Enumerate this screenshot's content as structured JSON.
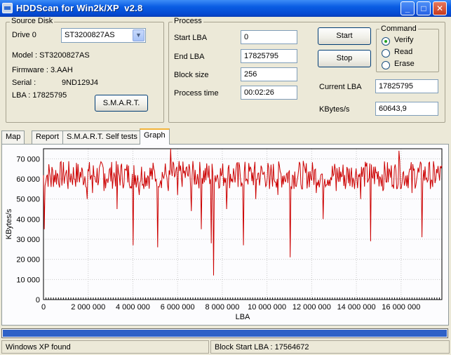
{
  "window": {
    "title": "HDDScan for Win2k/XP  v2.8"
  },
  "source_disk": {
    "group_label": "Source Disk",
    "drive_label": "Drive  0",
    "drive_value": "ST3200827AS",
    "model": "Model : ST3200827AS",
    "firmware": "Firmware : 3.AAH",
    "serial_label": "Serial :",
    "serial_value": "9ND129J4",
    "lba": "LBA :  17825795",
    "smart_button": "S.M.A.R.T."
  },
  "process": {
    "group_label": "Process",
    "start_lba_label": "Start LBA",
    "start_lba_value": "0",
    "end_lba_label": "End LBA",
    "end_lba_value": "17825795",
    "block_size_label": "Block size",
    "block_size_value": "256",
    "process_time_label": "Process time",
    "process_time_value": "00:02:26",
    "start_button": "Start",
    "stop_button": "Stop",
    "current_lba_label": "Current LBA",
    "current_lba_value": "17825795",
    "kbytes_label": "KBytes/s",
    "kbytes_value": "60643,9"
  },
  "command": {
    "group_label": "Command",
    "options": [
      "Verify",
      "Read",
      "Erase"
    ],
    "selected": "Verify"
  },
  "tabs": [
    "Map",
    "Report",
    "S.M.A.R.T. Self tests",
    "Graph"
  ],
  "active_tab": "Graph",
  "chart_data": {
    "type": "line",
    "xlabel": "LBA",
    "ylabel": "KBytes/s",
    "xlim": [
      0,
      17825795
    ],
    "ylim": [
      0,
      75000
    ],
    "x_ticks": [
      0,
      2000000,
      4000000,
      6000000,
      8000000,
      10000000,
      12000000,
      14000000,
      16000000
    ],
    "x_tick_labels": [
      "0",
      "2 000 000",
      "4 000 000",
      "6 000 000",
      "8 000 000",
      "10 000 000",
      "12 000 000",
      "14 000 000",
      "16 000 000"
    ],
    "y_ticks": [
      0,
      10000,
      20000,
      30000,
      40000,
      50000,
      60000,
      70000
    ],
    "y_tick_labels": [
      "0",
      "10 000",
      "20 000",
      "30 000",
      "40 000",
      "50 000",
      "60 000",
      "70 000"
    ],
    "grid": true,
    "line_color": "#cc0000",
    "baseline": 62000,
    "dips": [
      {
        "x": 50000,
        "y": 35000
      },
      {
        "x": 350000,
        "y": 56000
      },
      {
        "x": 1100000,
        "y": 55000
      },
      {
        "x": 1300000,
        "y": 57000
      },
      {
        "x": 1950000,
        "y": 50000
      },
      {
        "x": 2200000,
        "y": 53000
      },
      {
        "x": 2700000,
        "y": 54000
      },
      {
        "x": 3300000,
        "y": 45000
      },
      {
        "x": 4000000,
        "y": 27000
      },
      {
        "x": 4300000,
        "y": 52000
      },
      {
        "x": 5100000,
        "y": 26000
      },
      {
        "x": 5600000,
        "y": 54000
      },
      {
        "x": 6000000,
        "y": 52000
      },
      {
        "x": 6600000,
        "y": 44000
      },
      {
        "x": 7050000,
        "y": 35000
      },
      {
        "x": 7500000,
        "y": 28000
      },
      {
        "x": 7600000,
        "y": 12000
      },
      {
        "x": 8200000,
        "y": 45000
      },
      {
        "x": 8700000,
        "y": 56000
      },
      {
        "x": 8950000,
        "y": 27000
      },
      {
        "x": 9500000,
        "y": 50000
      },
      {
        "x": 10100000,
        "y": 55000
      },
      {
        "x": 10500000,
        "y": 52000
      },
      {
        "x": 11050000,
        "y": 21000
      },
      {
        "x": 11600000,
        "y": 55000
      },
      {
        "x": 12200000,
        "y": 53000
      },
      {
        "x": 12500000,
        "y": 40000
      },
      {
        "x": 13100000,
        "y": 54000
      },
      {
        "x": 13500000,
        "y": 55000
      },
      {
        "x": 14200000,
        "y": 50000
      },
      {
        "x": 14650000,
        "y": 29000
      },
      {
        "x": 15200000,
        "y": 54000
      },
      {
        "x": 15900000,
        "y": 55000
      },
      {
        "x": 16500000,
        "y": 53000
      },
      {
        "x": 16950000,
        "y": 31000
      },
      {
        "x": 17400000,
        "y": 56000
      }
    ],
    "peaks": [
      {
        "x": 5700000,
        "y": 75000
      },
      {
        "x": 15900000,
        "y": 74000
      }
    ]
  },
  "progress": {
    "value": 1.0
  },
  "status": {
    "left": "Windows XP found",
    "right": "Block Start LBA : 17564672"
  }
}
